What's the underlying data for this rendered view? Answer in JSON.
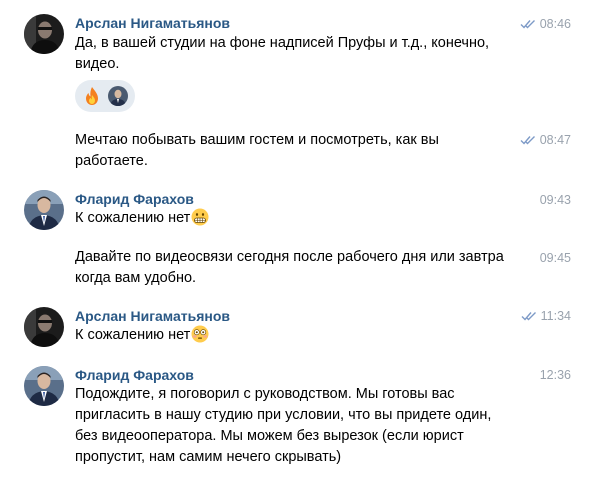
{
  "messages": [
    {
      "sender": "Арслан Нигаматьянов",
      "time": "08:46",
      "text": "Да, в вашей студии на фоне надписей Пруфы и т.д., конечно, видео.",
      "read": true
    },
    {
      "time": "08:47",
      "text": "Мечтаю побывать вашим гостем и посмотреть, как вы работаете.",
      "read": true
    },
    {
      "sender": "Фларид Фарахов",
      "time": "09:43",
      "text": "К сожалению нет",
      "emoji": "grimacing-face-emoji"
    },
    {
      "time": "09:45",
      "text": "Давайте по видеосвязи сегодня после рабочего дня или завтра когда вам удобно."
    },
    {
      "sender": "Арслан Нигаматьянов",
      "time": "11:34",
      "text": "К сожалению нет",
      "emoji": "flushed-face-emoji",
      "read": true
    },
    {
      "sender": "Фларид Фарахов",
      "time": "12:36",
      "text": "Подождите, я поговорил с руководством. Мы готовы вас пригласить в нашу студию при условии, что вы придете один, без видеооператора. Мы можем без вырезок (если юрист пропустит, нам самим нечего скрывать)"
    }
  ],
  "reactions": [
    "fire-emoji",
    "reactor-avatar"
  ],
  "colors": {
    "sender_name": "#2a5885",
    "time": "#99a2ad",
    "read_checks": "#7d9ac7",
    "reaction_bg": "#e5ebf1"
  }
}
